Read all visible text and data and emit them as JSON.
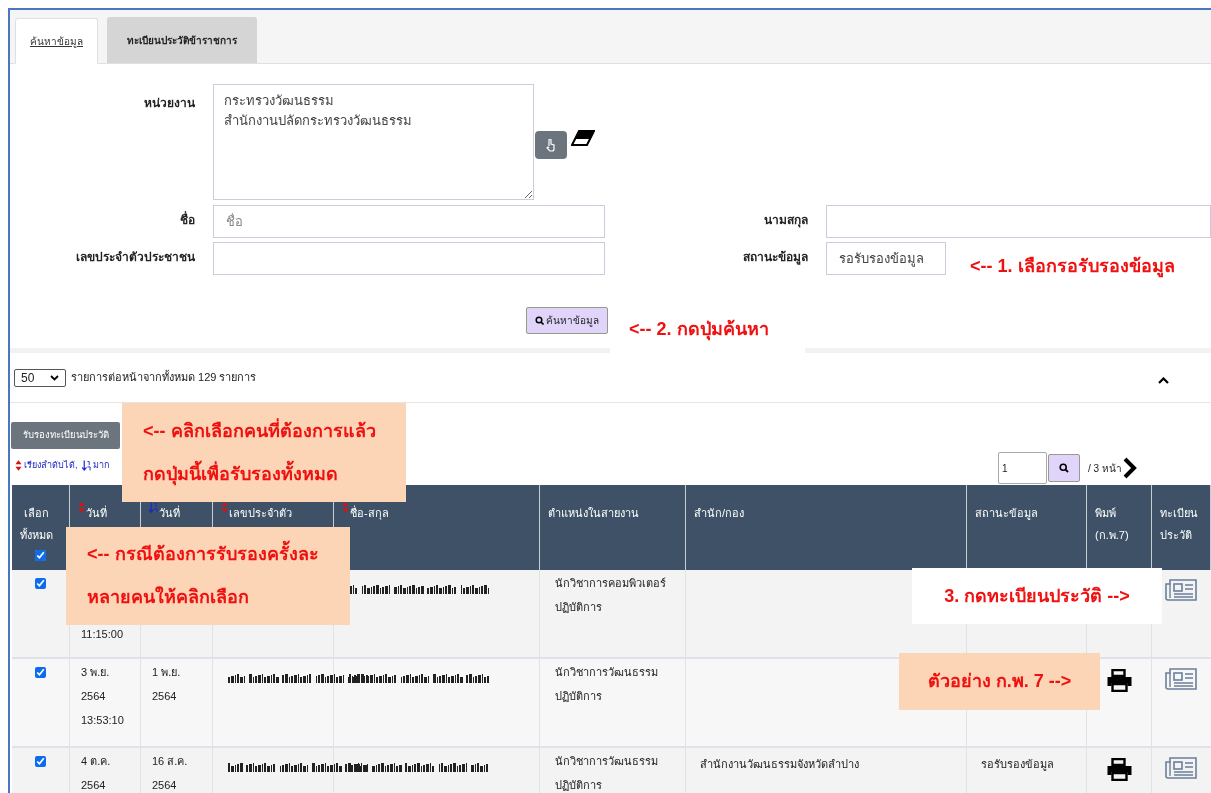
{
  "tabs": [
    {
      "label": "ค้นหาข้อมูล",
      "selected": true
    },
    {
      "label": "ทะเบียนประวัติข้าราชการ",
      "selected": false
    }
  ],
  "form": {
    "unit_label": "หน่วยงาน",
    "unit_value": "กระทรวงวัฒนธรรม\nสำนักงานปลัดกระทรวงวัฒนธรรม",
    "first_name_label": "ชื่อ",
    "first_name_placeholder": "ชื่อ",
    "last_name_label": "นามสกุล",
    "citizen_id_label": "เลขประจำตัวประชาชน",
    "status_label": "สถานะข้อมูล",
    "status_value": "รอรับรองข้อมูล",
    "search_button": "ค้นหาข้อมูล"
  },
  "list": {
    "page_size": "50",
    "summary": "รายการต่อหน้าจากทั้งหมด 129 รายการ",
    "approve_button": "รับรองทะเบียนประวัติ",
    "legend": [
      {
        "kind": "sortable",
        "text": "เรียงลำดับได้,"
      },
      {
        "kind": "sorted",
        "text": "มาก"
      }
    ],
    "page_input": "1",
    "page_total": "/ 3 หน้า"
  },
  "table": {
    "columns": [
      {
        "label": "เลือก\nทั้งหมด",
        "kind": "select_all",
        "checked": true
      },
      {
        "label": "วันที่",
        "kind": "sortable"
      },
      {
        "label": "วันที่",
        "kind": "sorted"
      },
      {
        "label": "เลขประจำตัว",
        "kind": "sortable"
      },
      {
        "label": "ชื่อ-สกุล",
        "kind": "sortable"
      },
      {
        "label": "ตำแหน่งในสายงาน",
        "kind": "plain"
      },
      {
        "label": "สำนัก/กอง",
        "kind": "plain"
      },
      {
        "label": "สถานะข้อมูล",
        "kind": "plain"
      },
      {
        "label": "พิมพ์\n(ก.พ.7)",
        "kind": "plain"
      },
      {
        "label": "ทะเบียน\nประวัติ",
        "kind": "plain"
      }
    ],
    "rows": [
      {
        "checked": true,
        "covered": true,
        "date_sent": [
          "11:15:00"
        ],
        "date_record": [],
        "id_redacted": false,
        "name_redacted": true,
        "position": [
          "นักวิชาการคอมพิวเตอร์",
          "ปฏิบัติการ"
        ],
        "division": "",
        "status": "",
        "print": false,
        "registry": true
      },
      {
        "checked": true,
        "covered": false,
        "date_sent": [
          "3 พ.ย.",
          "2564",
          "13:53:10"
        ],
        "date_record": [
          "1 พ.ย.",
          "2564"
        ],
        "id_redacted": true,
        "name_redacted": true,
        "position": [
          "นักวิชาการวัฒนธรรม",
          "ปฏิบัติการ"
        ],
        "division": "",
        "status": "",
        "print": true,
        "registry": true
      },
      {
        "checked": true,
        "covered": false,
        "date_sent": [
          "4 ต.ค.",
          "2564"
        ],
        "date_record": [
          "16 ส.ค.",
          "2564"
        ],
        "id_redacted": true,
        "name_redacted": true,
        "position": [
          "นักวิชาการวัฒนธรรม",
          "ปฏิบัติการ"
        ],
        "division": "สำนักงานวัฒนธรรมจังหวัดลำปาง",
        "status": "รอรับรองข้อมูล",
        "print": true,
        "registry": true
      }
    ]
  },
  "callouts": [
    {
      "text": [
        "<-- 1. เลือกรอรับรองข้อมูล"
      ],
      "kind": "white"
    },
    {
      "text": [
        "<-- 2. กดปุ่มค้นหา"
      ],
      "kind": "white"
    },
    {
      "text": [
        "<-- คลิกเลือกคนที่ต้องการแล้ว",
        "กดปุ่มนี้เพื่อรับรองทั้งหมด"
      ],
      "kind": "peach"
    },
    {
      "text": [
        "<-- กรณีต้องการรับรองครั้งละ",
        "หลายคนให้คลิกเลือก"
      ],
      "kind": "peach"
    },
    {
      "text": [
        "3. กดทะเบียนประวัติ -->"
      ],
      "kind": "white"
    },
    {
      "text": [
        "ตัวอย่าง ก.พ. 7 -->"
      ],
      "kind": "peach"
    }
  ]
}
